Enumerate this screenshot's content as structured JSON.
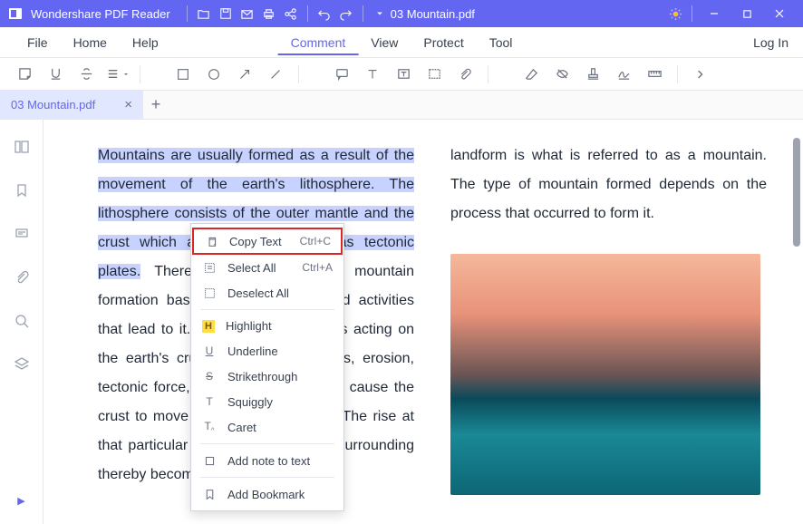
{
  "titlebar": {
    "app_title": "Wondershare PDF Reader",
    "filename": "03 Mountain.pdf"
  },
  "menubar": {
    "items_left": [
      "File",
      "Home",
      "Help"
    ],
    "items_center": [
      "Comment",
      "View",
      "Protect",
      "Tool"
    ],
    "active_index": 0,
    "login": "Log In"
  },
  "tab": {
    "label": "03 Mountain.pdf"
  },
  "document": {
    "left_highlighted": "Mountains are usually formed as a result of the movement of the earth's lithosphere. The lithosphere consists of the outer mantle and the crust which are also referred to as tectonic plates.",
    "left_rest": " There are four types of mountain formation based on the process and activities that lead to it. There are many forces acting on the earth's crust. The igneous forces, erosion, tectonic force, and isostatic forces all cause the crust to move upward or downward. The rise at that particular area rises above the surrounding thereby becoming the resultant",
    "right_text": "landform is what is referred to as a mountain. The type of mountain formed depends on the process that occurred to form it."
  },
  "context_menu": {
    "items": [
      {
        "icon": "copy",
        "label": "Copy Text",
        "shortcut": "Ctrl+C",
        "highlighted": true
      },
      {
        "icon": "select-all",
        "label": "Select All",
        "shortcut": "Ctrl+A"
      },
      {
        "icon": "deselect",
        "label": "Deselect All",
        "shortcut": ""
      },
      {
        "divider": true
      },
      {
        "icon": "highlight",
        "label": "Highlight",
        "shortcut": ""
      },
      {
        "icon": "underline",
        "label": "Underline",
        "shortcut": ""
      },
      {
        "icon": "strike",
        "label": "Strikethrough",
        "shortcut": ""
      },
      {
        "icon": "squiggly",
        "label": "Squiggly",
        "shortcut": ""
      },
      {
        "icon": "caret",
        "label": "Caret",
        "shortcut": ""
      },
      {
        "divider": true
      },
      {
        "icon": "note",
        "label": "Add note to text",
        "shortcut": ""
      },
      {
        "divider": true
      },
      {
        "icon": "bookmark",
        "label": "Add Bookmark",
        "shortcut": ""
      }
    ]
  }
}
